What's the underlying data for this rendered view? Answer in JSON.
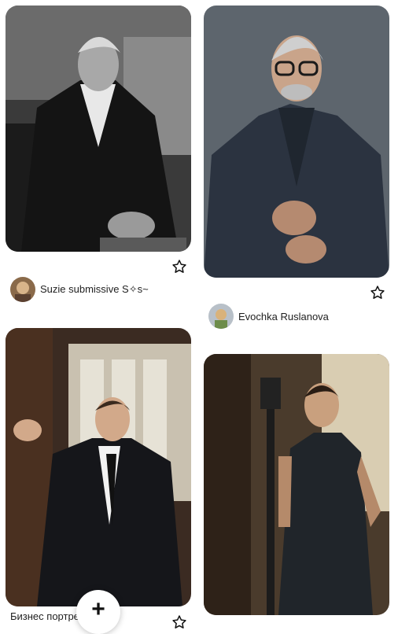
{
  "pins": [
    {
      "id": "pin-1",
      "author": "Suzie submissive S✧s~",
      "image": "black and white portrait of grey-haired bearded man in dark suit"
    },
    {
      "id": "pin-2",
      "author": "Evochka Ruslanova",
      "image": "grey-haired man with glasses in dark suit adjusting watch"
    },
    {
      "id": "pin-3",
      "author": "",
      "image": "man in black suit leaning on window frame"
    },
    {
      "id": "pin-4",
      "author": "",
      "image": "man in waistcoat standing beside studio light stand"
    }
  ],
  "partial_caption": "Бизнес портрет …",
  "fab": {
    "icon": "plus-icon",
    "glyph": "+"
  },
  "colors": {
    "text": "#1f1f1f",
    "background": "#ffffff"
  }
}
